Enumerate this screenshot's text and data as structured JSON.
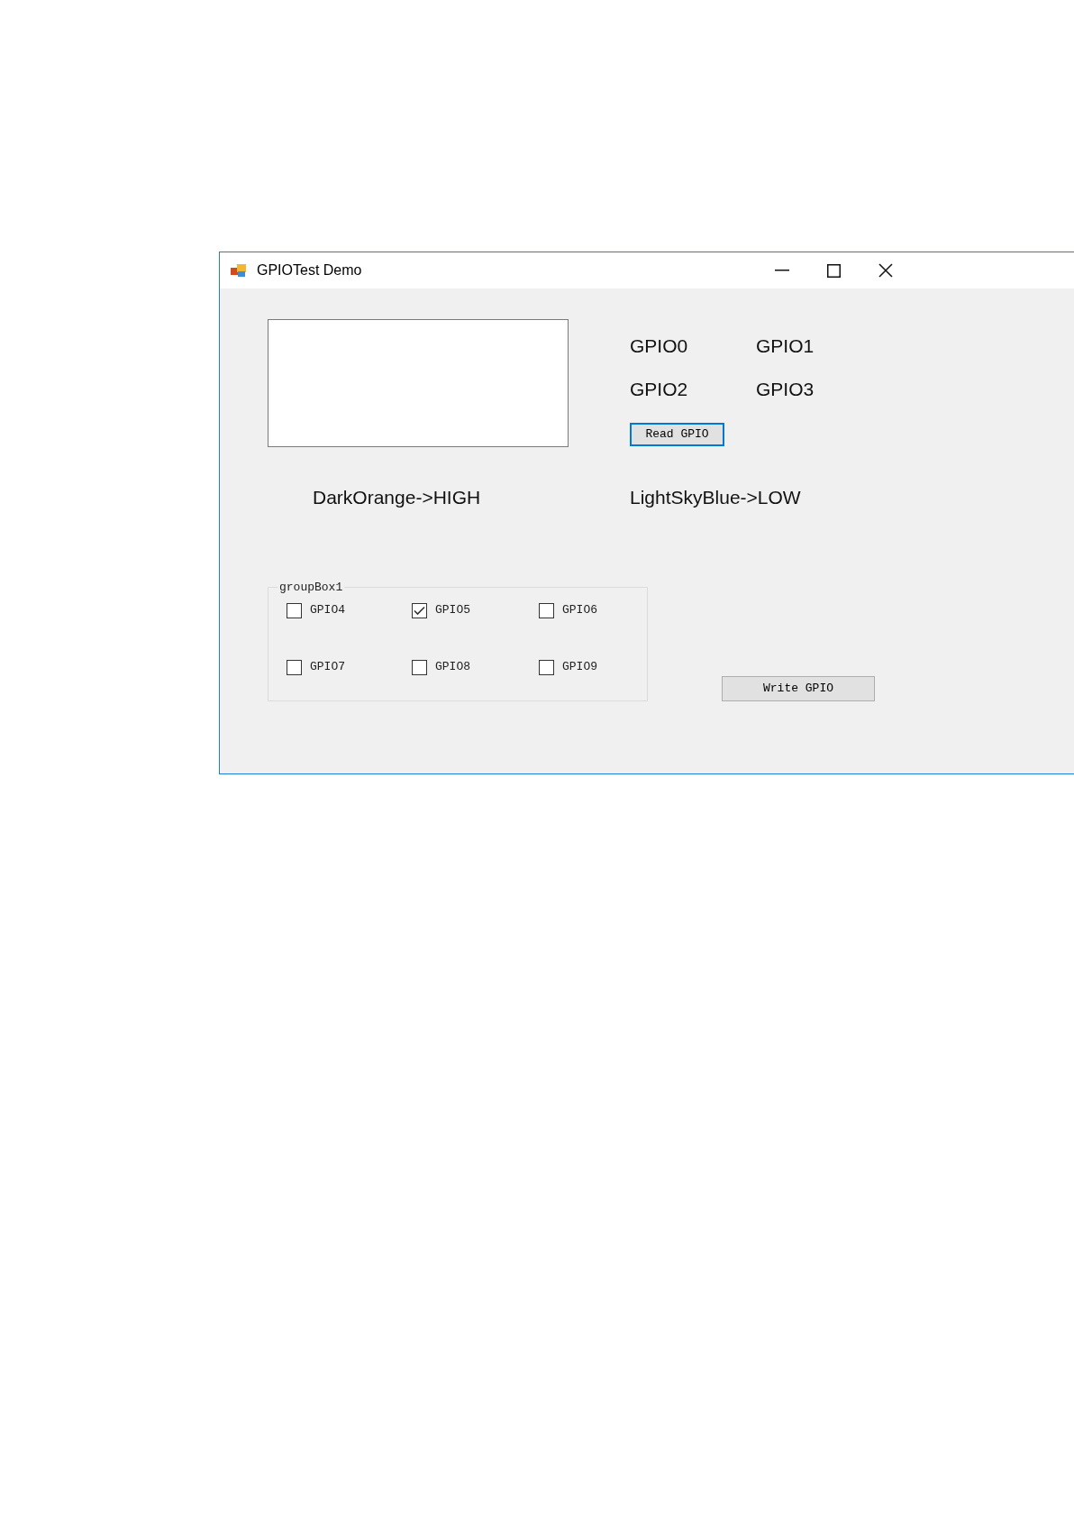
{
  "window": {
    "title": "GPIOTest Demo"
  },
  "gpio_labels": [
    "GPIO0",
    "GPIO1",
    "GPIO2",
    "GPIO3"
  ],
  "read_button": "Read GPIO",
  "legend": [
    "DarkOrange->HIGH",
    "LightSkyBlue->LOW"
  ],
  "group_box": {
    "title": "groupBox1",
    "checkboxes": [
      {
        "label": "GPIO4",
        "checked": false
      },
      {
        "label": "GPIO5",
        "checked": true
      },
      {
        "label": "GPIO6",
        "checked": false
      },
      {
        "label": "GPIO7",
        "checked": false
      },
      {
        "label": "GPIO8",
        "checked": false
      },
      {
        "label": "GPIO9",
        "checked": false
      }
    ]
  },
  "write_button": "Write GPIO"
}
